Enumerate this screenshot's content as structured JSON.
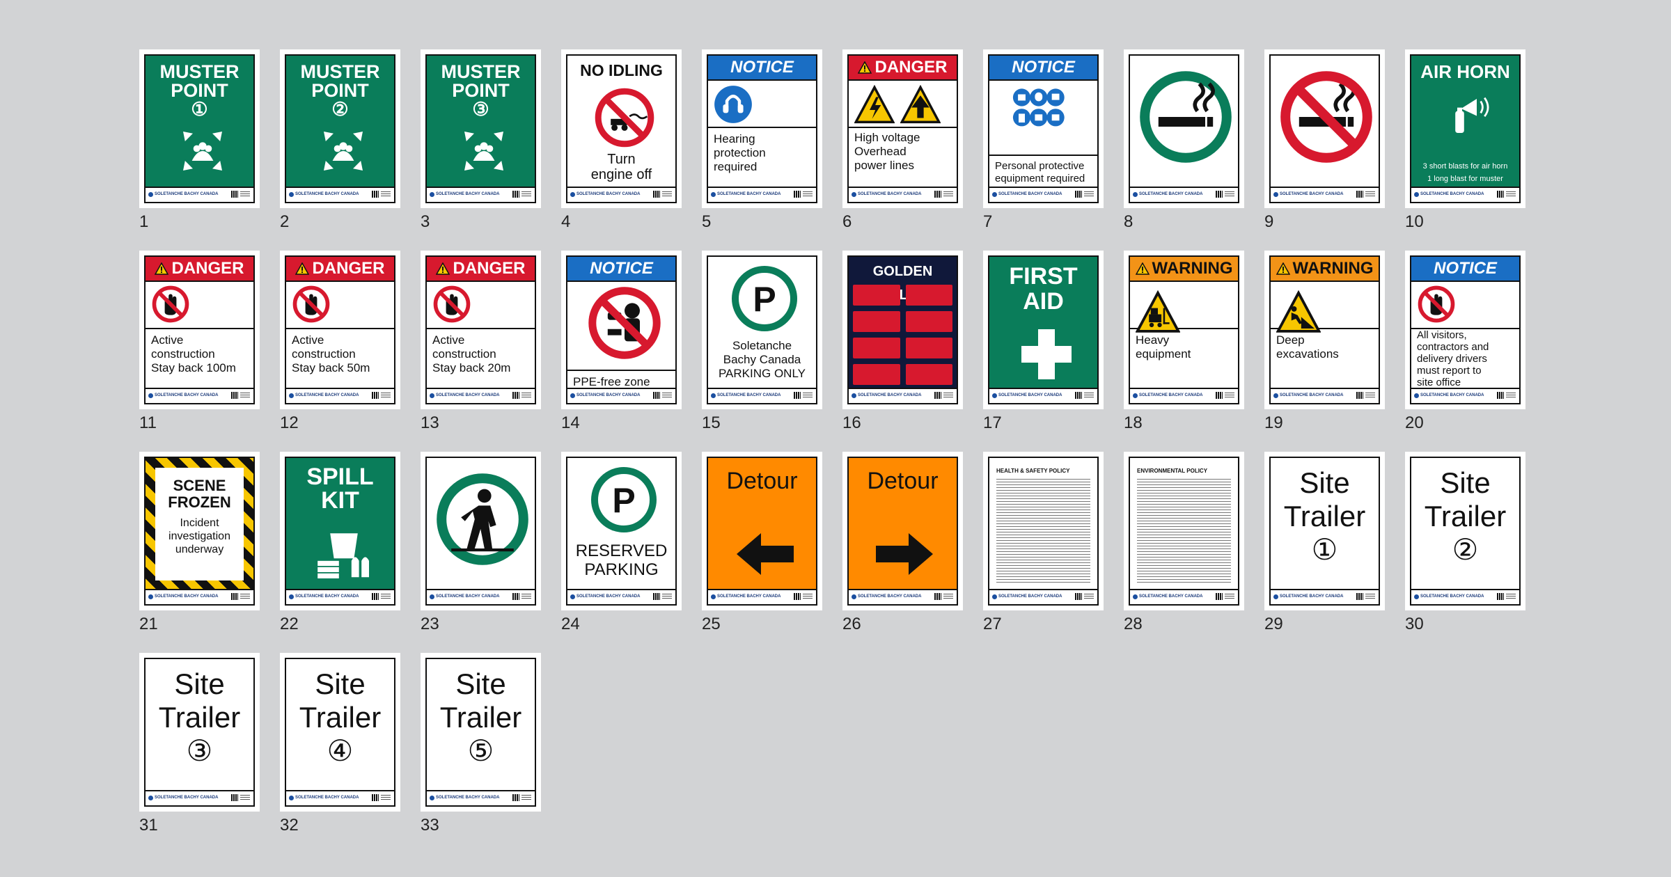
{
  "brand_text": "SOLETANCHE BACHY CANADA",
  "colors": {
    "background": "#d2d3d5",
    "safety_green": "#0a7d5a",
    "danger_red": "#d7192e",
    "notice_blue": "#1a6ec4",
    "warning_orange": "#f39317",
    "detour_orange": "#ff8a00"
  },
  "signs": [
    {
      "n": "1",
      "lines": [
        "MUSTER",
        "POINT",
        "①"
      ],
      "icon": "muster-arrows-icon"
    },
    {
      "n": "2",
      "lines": [
        "MUSTER",
        "POINT",
        "②"
      ],
      "icon": "muster-arrows-icon"
    },
    {
      "n": "3",
      "lines": [
        "MUSTER",
        "POINT",
        "③"
      ],
      "icon": "muster-arrows-icon"
    },
    {
      "n": "4",
      "title": "NO IDLING",
      "text": [
        "Turn",
        "engine off"
      ],
      "icon": "no-idling-icon"
    },
    {
      "n": "5",
      "header": "NOTICE",
      "text": [
        "Hearing",
        "protection",
        "required"
      ],
      "icon": "ear-protection-icon"
    },
    {
      "n": "6",
      "header": "DANGER",
      "text": [
        "High voltage",
        "Overhead",
        "power lines"
      ],
      "icon": "high-voltage-icon"
    },
    {
      "n": "7",
      "header": "NOTICE",
      "text": [
        "Personal protective",
        "equipment required"
      ],
      "icon": "ppe-icon"
    },
    {
      "n": "8",
      "icon": "smoking-area-icon"
    },
    {
      "n": "9",
      "icon": "no-smoking-icon"
    },
    {
      "n": "10",
      "title": "AIR HORN",
      "text": [
        "3 short blasts for air horn",
        "1 long blast for muster"
      ],
      "icon": "air-horn-icon"
    },
    {
      "n": "11",
      "header": "DANGER",
      "text": [
        "Active",
        "construction",
        "Stay back 100m"
      ],
      "icon": "no-entry-hand-icon"
    },
    {
      "n": "12",
      "header": "DANGER",
      "text": [
        "Active",
        "construction",
        "Stay back 50m"
      ],
      "icon": "no-entry-hand-icon"
    },
    {
      "n": "13",
      "header": "DANGER",
      "text": [
        "Active",
        "construction",
        "Stay back 20m"
      ],
      "icon": "no-entry-hand-icon"
    },
    {
      "n": "14",
      "header": "NOTICE",
      "text": [
        "PPE-free zone"
      ],
      "icon": "no-ppe-icon"
    },
    {
      "n": "15",
      "text": [
        "Soletanche",
        "Bachy Canada",
        "PARKING ONLY"
      ],
      "icon": "parking-icon"
    },
    {
      "n": "16",
      "title": "GOLDEN RULES",
      "icon": "golden-rules-poster-icon"
    },
    {
      "n": "17",
      "lines": [
        "FIRST",
        "AID"
      ],
      "icon": "cross-icon"
    },
    {
      "n": "18",
      "header": "WARNING",
      "text": [
        "Heavy",
        "equipment"
      ],
      "icon": "forklift-icon"
    },
    {
      "n": "19",
      "header": "WARNING",
      "text": [
        "Deep",
        "excavations"
      ],
      "icon": "excavation-icon"
    },
    {
      "n": "20",
      "header": "NOTICE",
      "text": [
        "All visitors,",
        "contractors and",
        "delivery drivers",
        "must report to",
        "site office"
      ],
      "icon": "no-entry-hand-icon"
    },
    {
      "n": "21",
      "lines": [
        "SCENE",
        "FROZEN"
      ],
      "text": [
        "Incident",
        "investigation",
        "underway"
      ],
      "icon": "hazard-stripes-icon"
    },
    {
      "n": "22",
      "lines": [
        "SPILL",
        "KIT"
      ],
      "icon": "spill-kit-icon"
    },
    {
      "n": "23",
      "icon": "pedestrian-icon"
    },
    {
      "n": "24",
      "text": [
        "RESERVED",
        "PARKING"
      ],
      "icon": "parking-icon"
    },
    {
      "n": "25",
      "title": "Detour",
      "icon": "arrow-left-icon"
    },
    {
      "n": "26",
      "title": "Detour",
      "icon": "arrow-right-icon"
    },
    {
      "n": "27",
      "title": "HEALTH & SAFETY POLICY",
      "icon": "document-text-icon"
    },
    {
      "n": "28",
      "title": "ENVIRONMENTAL POLICY",
      "icon": "document-text-icon"
    },
    {
      "n": "29",
      "lines": [
        "Site",
        "Trailer",
        "①"
      ]
    },
    {
      "n": "30",
      "lines": [
        "Site",
        "Trailer",
        "②"
      ]
    },
    {
      "n": "31",
      "lines": [
        "Site",
        "Trailer",
        "③"
      ]
    },
    {
      "n": "32",
      "lines": [
        "Site",
        "Trailer",
        "④"
      ]
    },
    {
      "n": "33",
      "lines": [
        "Site",
        "Trailer",
        "⑤"
      ]
    }
  ]
}
